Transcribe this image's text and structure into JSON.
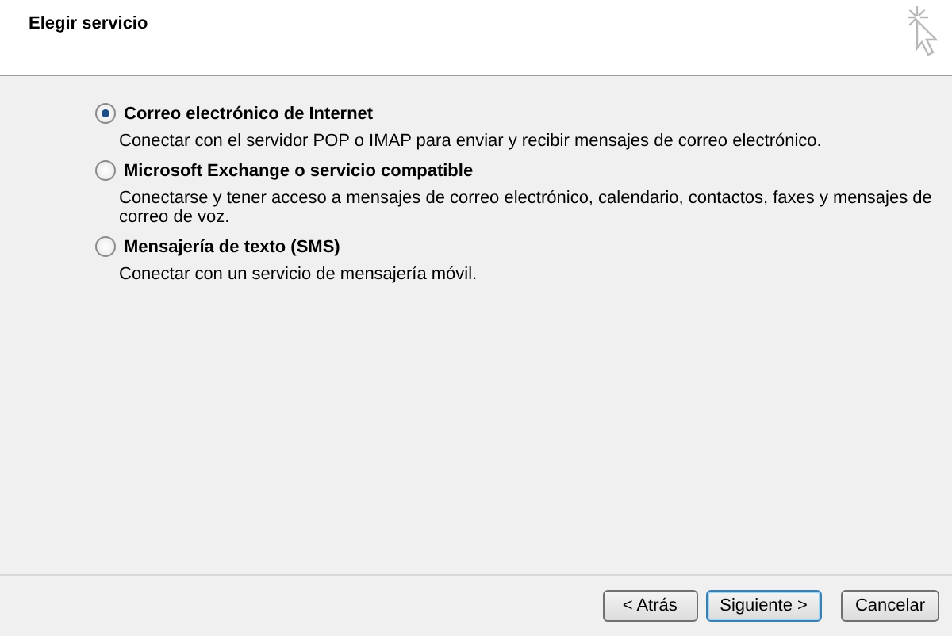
{
  "header": {
    "title": "Elegir servicio"
  },
  "options": [
    {
      "label": "Correo electrónico de Internet",
      "description": "Conectar con el servidor POP o IMAP para enviar y recibir mensajes de correo electrónico.",
      "selected": true
    },
    {
      "label": "Microsoft Exchange o servicio compatible",
      "description": "Conectarse y tener acceso a mensajes de correo electrónico, calendario, contactos, faxes y mensajes de correo de voz.",
      "selected": false
    },
    {
      "label": "Mensajería de texto (SMS)",
      "description": "Conectar con un servicio de mensajería móvil.",
      "selected": false
    }
  ],
  "buttons": [
    {
      "label": "< Atrás",
      "default": false
    },
    {
      "label": "Siguiente >",
      "default": true
    },
    {
      "label": "Cancelar",
      "default": false
    }
  ]
}
